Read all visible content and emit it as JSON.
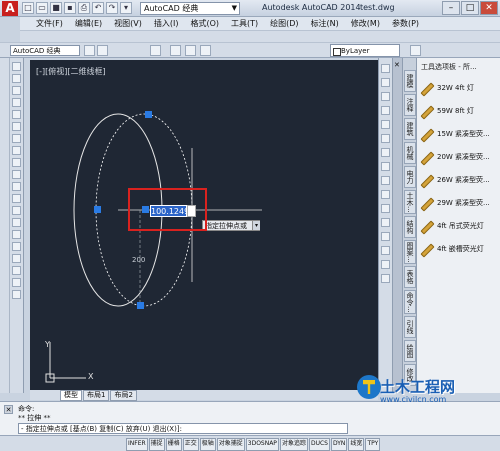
{
  "title_bar": {
    "workspace": "AutoCAD 经典",
    "app_title": "Autodesk AutoCAD 2014",
    "file_name": "test.dwg"
  },
  "menu": {
    "items": [
      "文件(F)",
      "编辑(E)",
      "视图(V)",
      "插入(I)",
      "格式(O)",
      "工具(T)",
      "绘图(D)",
      "标注(N)",
      "修改(M)",
      "参数(P)"
    ]
  },
  "toolbar2": {
    "workspace": "AutoCAD 经典",
    "layer": "ByLayer"
  },
  "canvas": {
    "view_label": "[-][俯视][二维线框]",
    "dyn_input_value": "100.1249",
    "tooltip": "指定拉伸点或",
    "dimension_label": "200",
    "ucs_x": "X",
    "ucs_y": "Y"
  },
  "palette": {
    "title": "工具选项板 - 所...",
    "items": [
      "32W 4ft 灯",
      "59W 8ft 灯",
      "15W 紧凑型荧...",
      "20W 紧凑型荧...",
      "26W 紧凑型荧...",
      "29W 紧凑型荧...",
      "4ft 吊式荧光灯",
      "4ft 嵌槽荧光灯"
    ],
    "tabs": [
      "建模",
      "注释",
      "建筑",
      "机械",
      "电力",
      "土木...",
      "结构",
      "图案...",
      "表格",
      "命令...",
      "引线",
      "绘图",
      "修改"
    ]
  },
  "layout_tabs": [
    "模型",
    "布局1",
    "布局2"
  ],
  "command": {
    "line1": "命令:",
    "line2": "** 拉伸 **",
    "input": "- 指定拉伸点或 [基点(B) 复制(C) 放弃(U) 退出(X)]:"
  },
  "status": {
    "buttons": [
      "INFER",
      "捕捉",
      "栅格",
      "正交",
      "极轴",
      "对象捕捉",
      "3DOSNAP",
      "对象追踪",
      "DUCS",
      "DYN",
      "线宽",
      "TPY"
    ]
  },
  "watermark": {
    "text": "土木工程网",
    "url": "www.civilcn.com"
  }
}
